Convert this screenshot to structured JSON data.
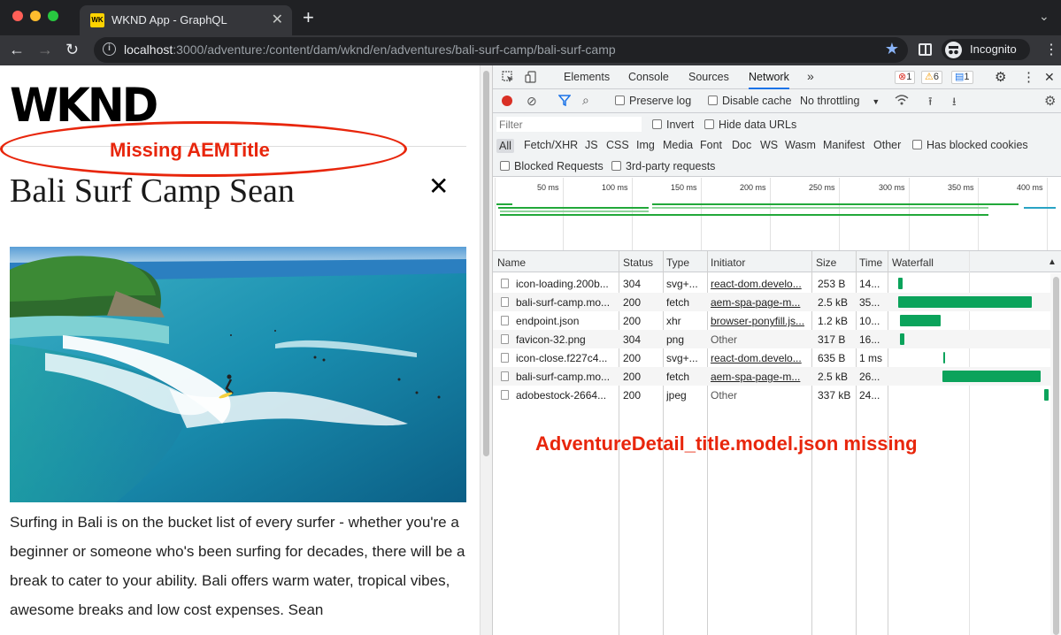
{
  "browser": {
    "tab_title": "WKND App - GraphQL",
    "tab_favicon_text": "WK",
    "url_host": "localhost",
    "url_path": ":3000/adventure:/content/dam/wknd/en/adventures/bali-surf-camp/bali-surf-camp",
    "profile_label": "Incognito",
    "traffic_light_colors": [
      "#ff5f57",
      "#febc2e",
      "#28c840"
    ]
  },
  "page": {
    "logo": "WKND",
    "annotation_missing_title": "Missing AEMTitle",
    "title": "Bali Surf Camp Sean",
    "close_glyph": "✕",
    "description": "Surfing in Bali is on the bucket list of every surfer - whether you're a beginner or someone who's been surfing for decades, there will be a break to cater to your ability. Bali offers warm water, tropical vibes, awesome breaks and low cost expenses. Sean"
  },
  "devtools": {
    "tabs": [
      "Elements",
      "Console",
      "Sources",
      "Network"
    ],
    "active_tab": "Network",
    "more_tabs": "»",
    "badges": {
      "errors": "1",
      "warnings": "6",
      "messages": "1"
    },
    "controls": {
      "preserve_log": "Preserve log",
      "disable_cache": "Disable cache",
      "throttling": "No throttling"
    },
    "filter": {
      "placeholder": "Filter",
      "invert": "Invert",
      "hide_data_urls": "Hide data URLs",
      "types": [
        "All",
        "Fetch/XHR",
        "JS",
        "CSS",
        "Img",
        "Media",
        "Font",
        "Doc",
        "WS",
        "Wasm",
        "Manifest",
        "Other"
      ],
      "has_blocked_cookies": "Has blocked cookies",
      "blocked_requests": "Blocked Requests",
      "third_party": "3rd-party requests"
    },
    "timeline_ticks": [
      "50 ms",
      "100 ms",
      "150 ms",
      "200 ms",
      "250 ms",
      "300 ms",
      "350 ms",
      "400 ms"
    ],
    "columns": [
      "Name",
      "Status",
      "Type",
      "Initiator",
      "Size",
      "Time",
      "Waterfall"
    ],
    "rows": [
      {
        "name": "icon-loading.200b...",
        "status": "304",
        "type": "svg+...",
        "initiator": "react-dom.develo...",
        "initiator_link": true,
        "size": "253 B",
        "time": "14...",
        "wf_start": 0.04,
        "wf_len": 0.03
      },
      {
        "name": "bali-surf-camp.mo...",
        "status": "200",
        "type": "fetch",
        "initiator": "aem-spa-page-m...",
        "initiator_link": true,
        "size": "2.5 kB",
        "time": "35...",
        "wf_start": 0.04,
        "wf_len": 0.85
      },
      {
        "name": "endpoint.json",
        "status": "200",
        "type": "xhr",
        "initiator": "browser-ponyfill.js...",
        "initiator_link": true,
        "size": "1.2 kB",
        "time": "10...",
        "wf_start": 0.05,
        "wf_len": 0.26
      },
      {
        "name": "favicon-32.png",
        "status": "304",
        "type": "png",
        "initiator": "Other",
        "initiator_link": false,
        "size": "317 B",
        "time": "16...",
        "wf_start": 0.05,
        "wf_len": 0.03
      },
      {
        "name": "icon-close.f227c4...",
        "status": "200",
        "type": "svg+...",
        "initiator": "react-dom.develo...",
        "initiator_link": true,
        "size": "635 B",
        "time": "1 ms",
        "wf_start": 0.33,
        "wf_len": 0.01
      },
      {
        "name": "bali-surf-camp.mo...",
        "status": "200",
        "type": "fetch",
        "initiator": "aem-spa-page-m...",
        "initiator_link": true,
        "size": "2.5 kB",
        "time": "26...",
        "wf_start": 0.32,
        "wf_len": 0.63
      },
      {
        "name": "adobestock-2664...",
        "status": "200",
        "type": "jpeg",
        "initiator": "Other",
        "initiator_link": false,
        "size": "337 kB",
        "time": "24...",
        "wf_start": 0.97,
        "wf_len": 0.03
      }
    ],
    "annotation_missing_model": "AdventureDetail_title.model.json missing"
  }
}
